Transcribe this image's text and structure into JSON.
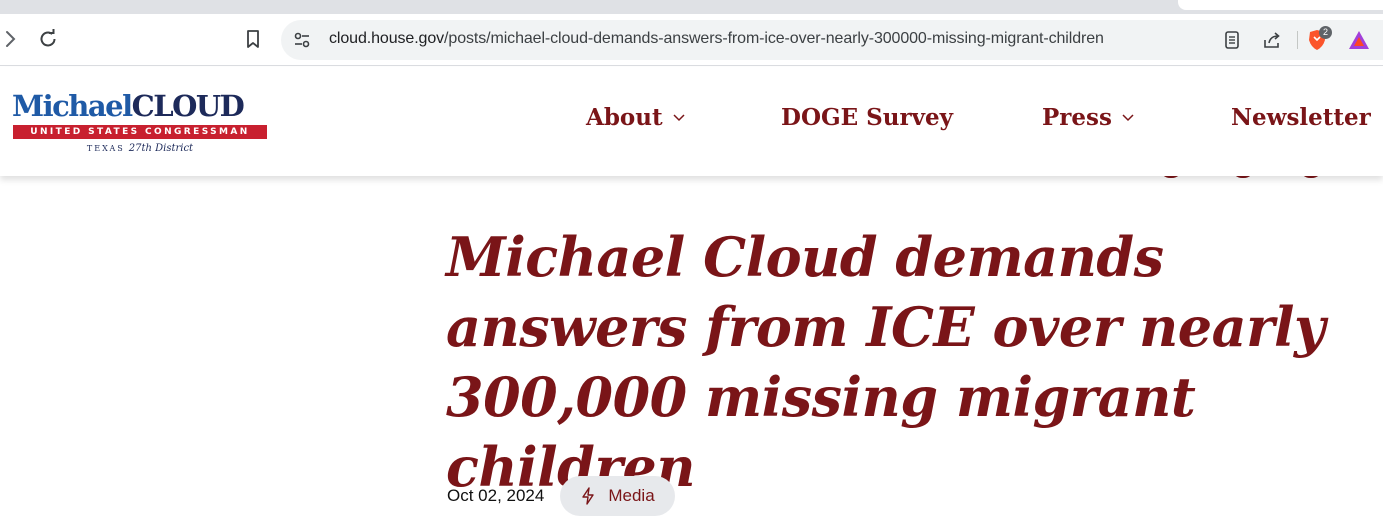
{
  "browser": {
    "url_host": "cloud.house.gov",
    "url_path": "/posts/michael-cloud-demands-answers-from-ice-over-nearly-300000-missing-migrant-children",
    "brave_shield_count": "2",
    "icons": [
      "forward-icon",
      "reload-icon",
      "bookmark-icon",
      "site-settings-icon",
      "reader-mode-icon",
      "share-icon",
      "brave-shields-icon",
      "brave-rewards-icon"
    ]
  },
  "site": {
    "logo": {
      "first": "Michael",
      "last": "CLOUD",
      "band": "UNITED STATES CONGRESSMAN",
      "state": "TEXAS",
      "district": "27th District"
    },
    "nav": [
      {
        "label": "About",
        "has_dropdown": true
      },
      {
        "label": "DOGE Survey",
        "has_dropdown": false
      },
      {
        "label": "Press",
        "has_dropdown": true
      },
      {
        "label": "Newsletter",
        "has_dropdown": false
      }
    ]
  },
  "article": {
    "title": "Michael Cloud demands answers from ICE over nearly 300,000 missing migrant children",
    "date": "Oct 02, 2024",
    "category": "Media"
  },
  "colors": {
    "brand_maroon": "#7a1518",
    "logo_blue": "#1f5aa6",
    "logo_navy": "#1d2a5a",
    "logo_red": "#c8202f",
    "badge_bg": "#e7e9ec"
  }
}
